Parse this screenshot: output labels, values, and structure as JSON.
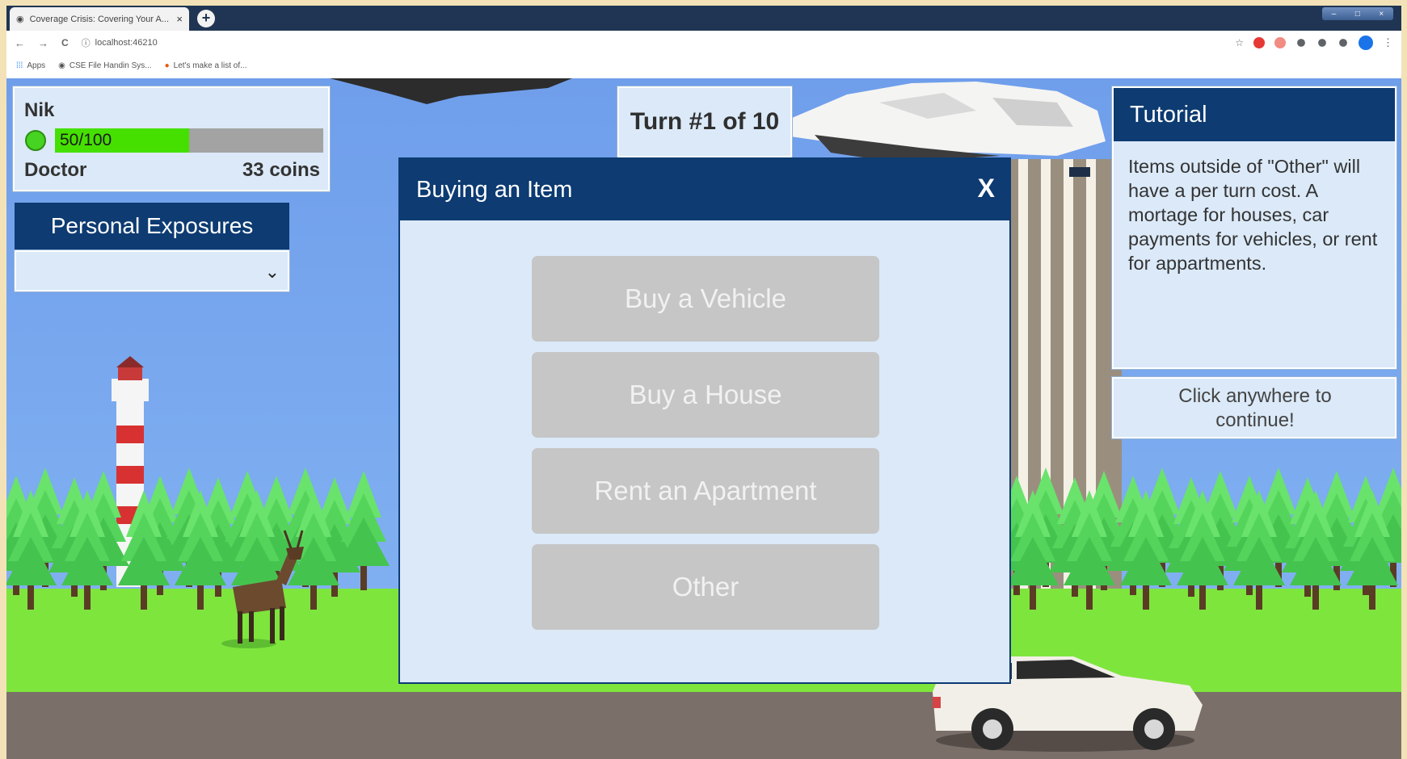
{
  "browser": {
    "tab_title": "Coverage Crisis: Covering Your A...",
    "tab_close": "×",
    "new_tab": "+",
    "window_controls": [
      "–",
      "□",
      "×"
    ],
    "nav": {
      "back": "←",
      "forward": "→",
      "reload": "C"
    },
    "url": "localhost:46210",
    "bookmarks": [
      "Apps",
      "CSE File Handin Sys...",
      "Let's make a list of..."
    ],
    "extension_colors": [
      "#e53935",
      "#f28b82",
      "#5f6368",
      "#5f6368",
      "#5f6368",
      "#1a73e8"
    ],
    "menu": "⋮"
  },
  "hud": {
    "player_name": "Nik",
    "health_text": "50/100",
    "health_fraction": 0.5,
    "profession": "Doctor",
    "coins": "33 coins",
    "exposures_title": "Personal Exposures",
    "exposures_chevron": "⌄",
    "turn": "Turn #1 of 10"
  },
  "modal": {
    "title": "Buying an Item",
    "close": "X",
    "options": [
      "Buy a Vehicle",
      "Buy a House",
      "Rent an Apartment",
      "Other"
    ]
  },
  "tutorial": {
    "title": "Tutorial",
    "body": "Items outside of \"Other\" will have a per turn cost. A mortage for houses, car payments for vehicles, or rent for appartments.",
    "continue": "Click anywhere to continue!"
  },
  "colors": {
    "sky": "#7aa7ee",
    "grass": "#7ee53d",
    "panel_header": "#0d3b72",
    "panel_body": "#dbe9f8",
    "health": "#45e000",
    "button": "#c6c6c6"
  }
}
